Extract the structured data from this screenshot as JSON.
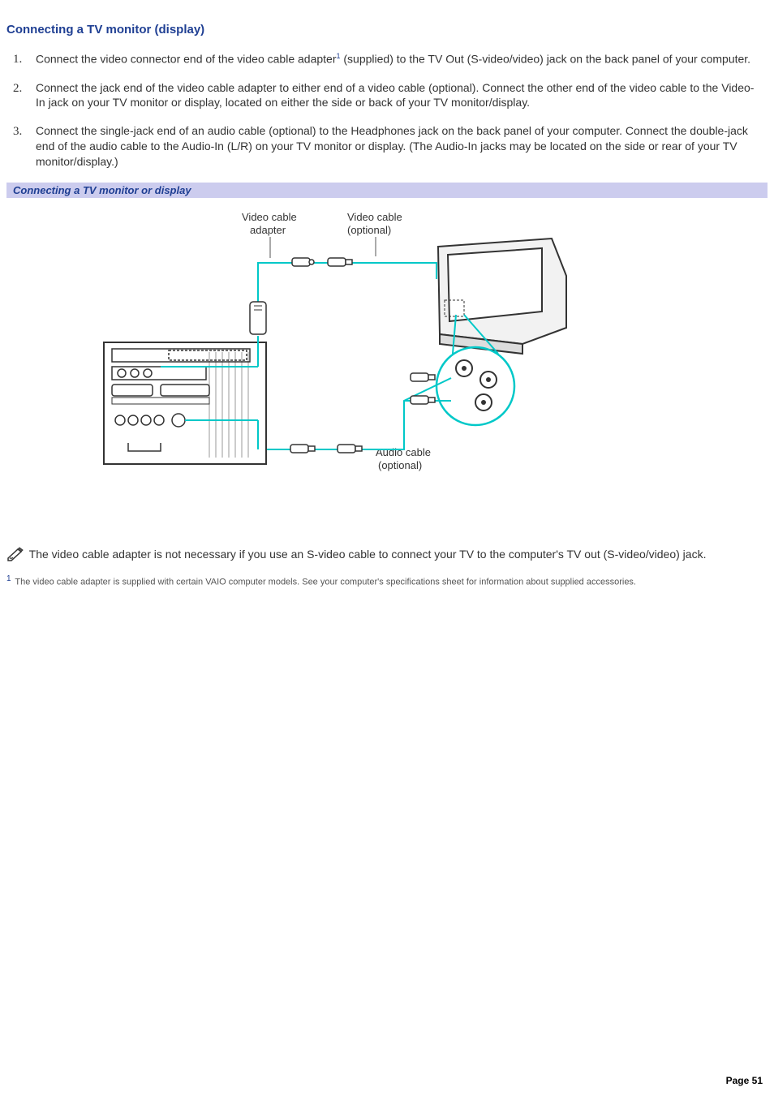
{
  "title": "Connecting a TV monitor (display)",
  "steps": [
    {
      "pre": "Connect the video connector end of the video cable adapter",
      "fn": "1",
      "post": " (supplied) to the TV Out (S-video/video) jack on the back panel of your computer."
    },
    {
      "pre": "Connect the jack end of the video cable adapter to either end of a video cable (optional). Connect the other end of the video cable to the Video-In jack on your TV monitor or display, located on either the side or back of your TV monitor/display.",
      "fn": "",
      "post": ""
    },
    {
      "pre": "Connect the single-jack end of an audio cable (optional) to the Headphones jack on the back panel of your computer. Connect the double-jack end of the audio cable to the Audio-In (L/R) on your TV monitor or display. (The Audio-In jacks may be located on the side or rear of your TV monitor/display.)",
      "fn": "",
      "post": ""
    }
  ],
  "figure_caption": "Connecting a TV monitor or display",
  "diagram_labels": {
    "video_adapter_l1": "Video cable",
    "video_adapter_l2": "adapter",
    "video_optional_l1": "Video cable",
    "video_optional_l2": "(optional)",
    "audio_l1": "Audio cable",
    "audio_l2": "(optional)"
  },
  "note_text": " The video cable adapter is not necessary if you use an S-video cable to connect your TV to the computer's TV out (S-video/video) jack.",
  "footnote": {
    "ref": "1",
    "text": " The video cable adapter is supplied with certain VAIO computer models. See your computer's specifications sheet for information about supplied accessories."
  },
  "page_label": "Page 51"
}
